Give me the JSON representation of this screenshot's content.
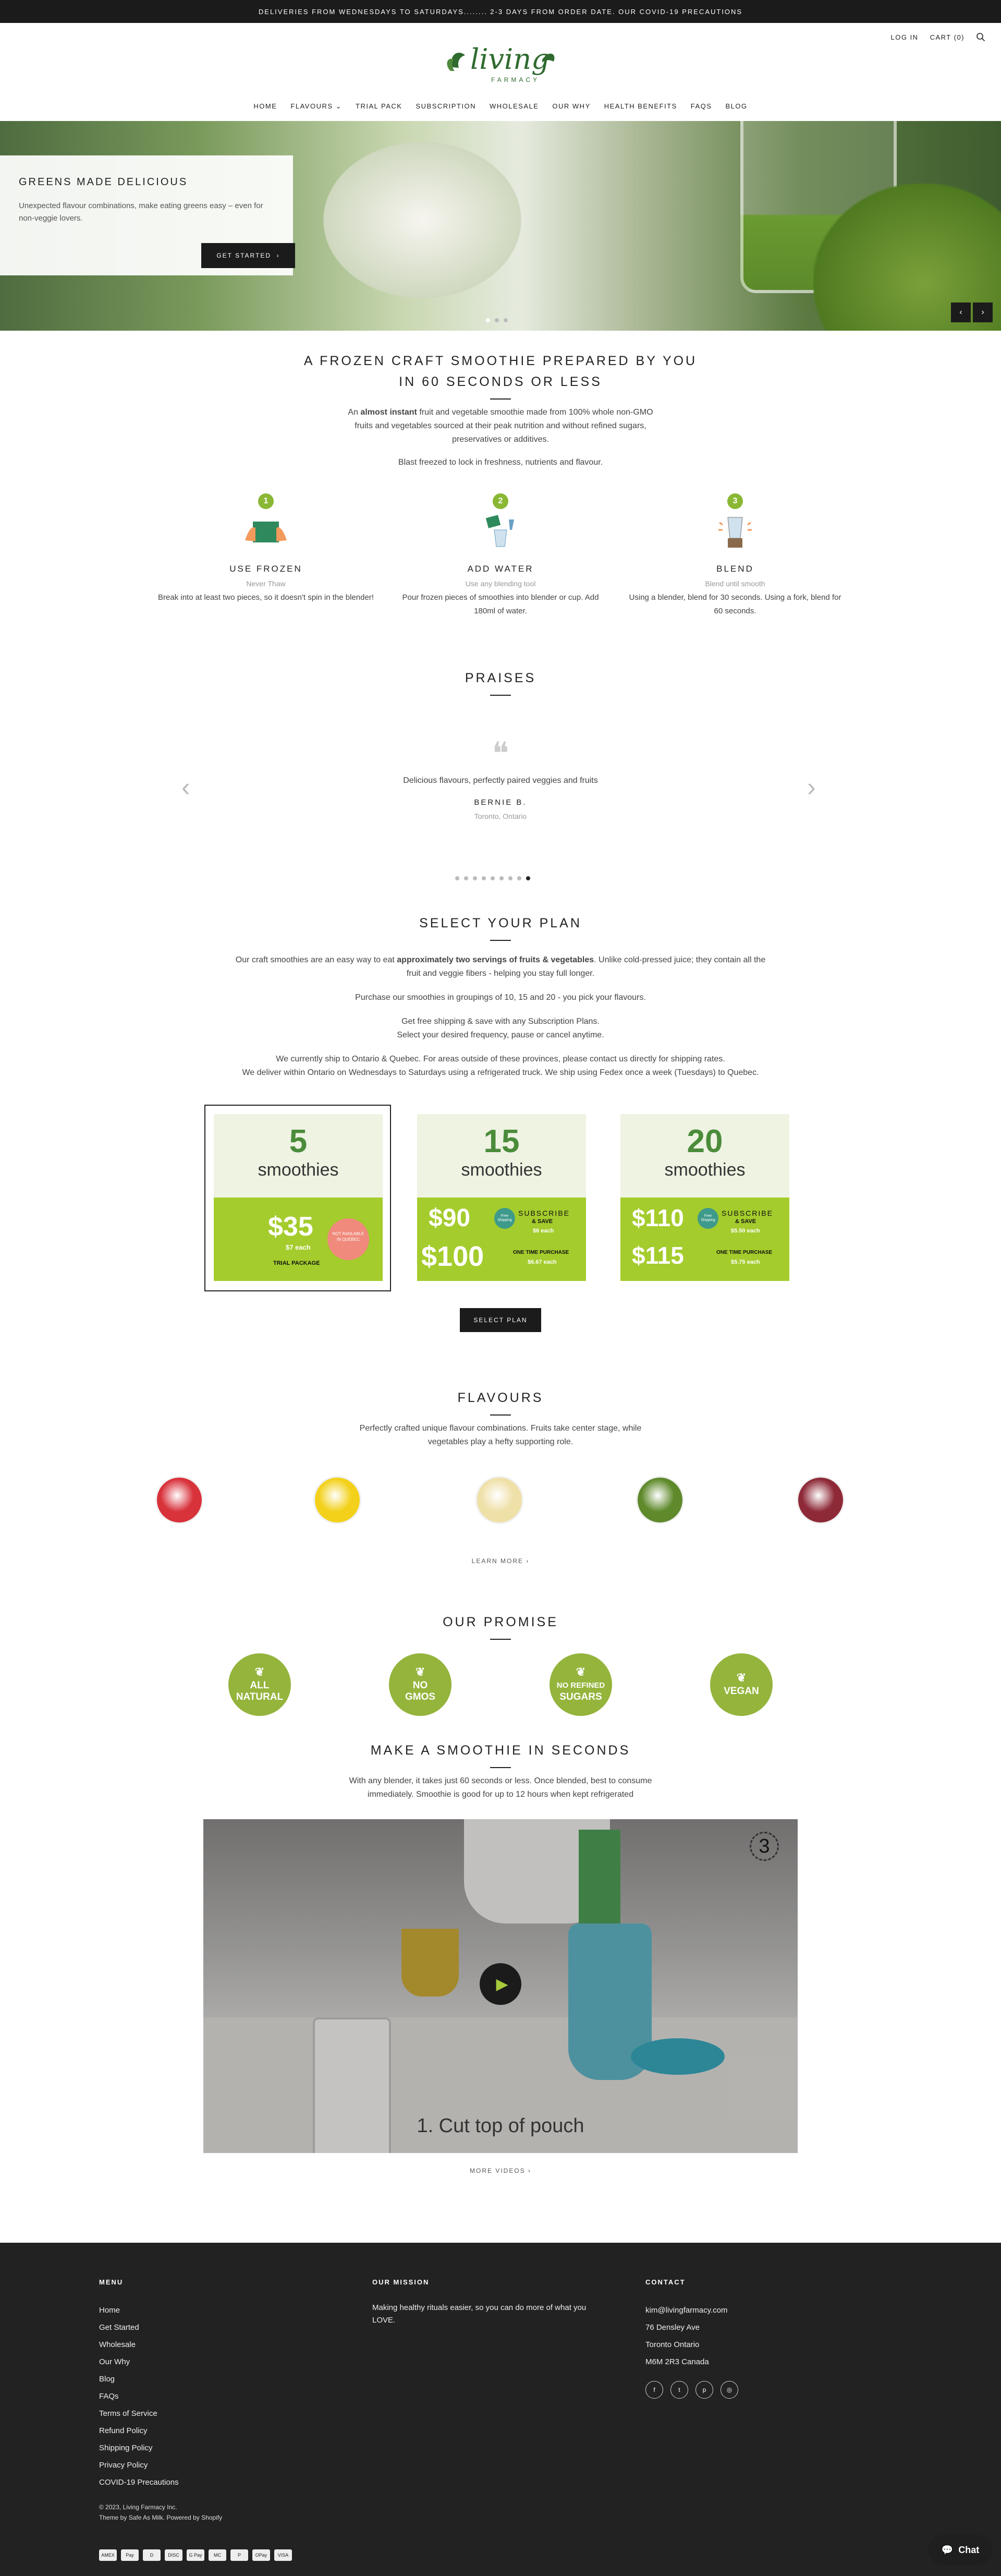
{
  "announcement": "DELIVERIES FROM WEDNESDAYS TO SATURDAYS........ 2-3 DAYS FROM ORDER DATE. OUR COVID-19 PRECAUTIONS",
  "header": {
    "login": "LOG IN",
    "cart": "CART (0)",
    "logo_main": "living",
    "logo_sub": "FARMACY"
  },
  "nav": [
    "HOME",
    "FLAVOURS",
    "TRIAL PACK",
    "SUBSCRIPTION",
    "WHOLESALE",
    "OUR WHY",
    "HEALTH BENEFITS",
    "FAQS",
    "BLOG"
  ],
  "hero": {
    "title": "GREENS MADE DELICIOUS",
    "text": "Unexpected flavour combinations, make eating greens easy – even for non-veggie lovers.",
    "button": "GET STARTED"
  },
  "intro": {
    "title1": "A FROZEN CRAFT SMOOTHIE PREPARED BY YOU",
    "title2": "IN 60 SECONDS OR LESS",
    "line1a": "An ",
    "line1b": "almost instant",
    "line1c": " fruit and vegetable smoothie made from 100% whole non-GMO",
    "line2": "fruits and vegetables sourced at their peak nutrition and without refined sugars,",
    "line3": "preservatives or additives.",
    "line4": "Blast freezed to lock in freshness, nutrients and flavour."
  },
  "steps": [
    {
      "num": "1",
      "title": "USE FROZEN",
      "sub": "Never Thaw",
      "text": "Break into at least two pieces, so it doesn't  spin in the blender!"
    },
    {
      "num": "2",
      "title": "ADD WATER",
      "sub": "Use any blending tool",
      "text": "Pour frozen pieces of smoothies into blender or cup. Add 180ml of water."
    },
    {
      "num": "3",
      "title": "BLEND",
      "sub": "Blend until smooth",
      "text": "Using a blender, blend for 30 seconds.  Using a fork, blend for 60 seconds."
    }
  ],
  "praises": {
    "title": "PRAISES",
    "quote": "Delicious flavours, perfectly paired veggies and fruits",
    "author": "BERNIE B.",
    "location": "Toronto, Ontario"
  },
  "plan": {
    "title": "SELECT YOUR PLAN",
    "p1a": "Our craft smoothies are an easy way to eat ",
    "p1b": "approximately two servings of fruits & vegetables",
    "p1c": ". Unlike cold-pressed juice; they contain all the",
    "p1d": "fruit and veggie fibers - helping you stay full longer.",
    "p2": "Purchase our smoothies in groupings of 10, 15 and 20 - you pick your flavours.",
    "p3a": "Get free shipping & save with any Subscription Plans.",
    "p3b": "Select your desired frequency, pause or cancel anytime.",
    "p4a": "We currently ship to Ontario & Quebec. For areas outside of these provinces, please contact us directly for shipping rates.",
    "p4b": "We deliver within Ontario on Wednesdays to Saturdays using a refrigerated truck. We ship using Fedex once a week (Tuesdays) to Quebec.",
    "button": "SELECT PLAN"
  },
  "plans": [
    {
      "count": "5",
      "unit": "smoothies",
      "price": "$35",
      "each": "$7 each",
      "label": "TRIAL PACKAGE",
      "badge": "NOT AVAILABLE IN QUEBEC"
    },
    {
      "count": "15",
      "unit": "smoothies",
      "price1": "$90",
      "save": "Free Shipping",
      "sub": "SUBSCRIBE",
      "sub2": "& SAVE",
      "each1": "$6 each",
      "price2": "$100",
      "once": "ONE TIME PURCHASE",
      "each2": "$6.67 each"
    },
    {
      "count": "20",
      "unit": "smoothies",
      "price1": "$110",
      "save": "Free Shipping",
      "sub": "SUBSCRIBE",
      "sub2": "& SAVE",
      "each1": "$5.50 each",
      "price2": "$115",
      "once": "ONE TIME PURCHASE",
      "each2": "$5.75 each"
    }
  ],
  "flavours": {
    "title": "FLAVOURS",
    "line1": "Perfectly crafted unique flavour combinations.  Fruits take center stage, while",
    "line2": "vegetables play a hefty supporting role.",
    "learn": "LEARN MORE"
  },
  "swatch_colors": [
    "#d8323b",
    "#f3d11a",
    "#efe0a8",
    "#5f8a2c",
    "#8e2a38"
  ],
  "promise": {
    "title": "OUR PROMISE",
    "items": [
      [
        "ALL",
        "NATURAL"
      ],
      [
        "NO",
        "GMOS"
      ],
      [
        "NO REFINED",
        "SUGARS"
      ],
      [
        "VEGAN",
        ""
      ]
    ]
  },
  "smoothie": {
    "title": "MAKE A SMOOTHIE IN SECONDS",
    "line1": "With any blender, it takes just 60 seconds or less.   Once blended, best to consume",
    "line2": "immediately.   Smoothie is good for up to 12 hours when kept refrigerated",
    "caption": "1. Cut top of pouch",
    "step": "3",
    "more": "MORE VIDEOS"
  },
  "footer": {
    "menu_title": "MENU",
    "menu": [
      "Home",
      "Get Started",
      "Wholesale",
      "Our Why",
      "Blog",
      "FAQs",
      "Terms of Service",
      "Refund Policy",
      "Shipping Policy",
      "Privacy Policy",
      "COVID-19 Precautions"
    ],
    "mission_title": "OUR MISSION",
    "mission": "Making healthy rituals easier, so you can do more of what you LOVE.",
    "contact_title": "CONTACT",
    "contact": [
      "kim@livingfarmacy.com",
      "76 Densley Ave",
      "Toronto Ontario",
      "M6M 2R3 Canada"
    ],
    "copy": "© 2023, Living Farmacy Inc.",
    "theme": "Theme by Safe As Milk. Powered by Shopify"
  },
  "payments": [
    "AMEX",
    "Pay",
    "D",
    "DISC",
    "G Pay",
    "MC",
    "P",
    "OPay",
    "VISA"
  ],
  "chat": "Chat"
}
